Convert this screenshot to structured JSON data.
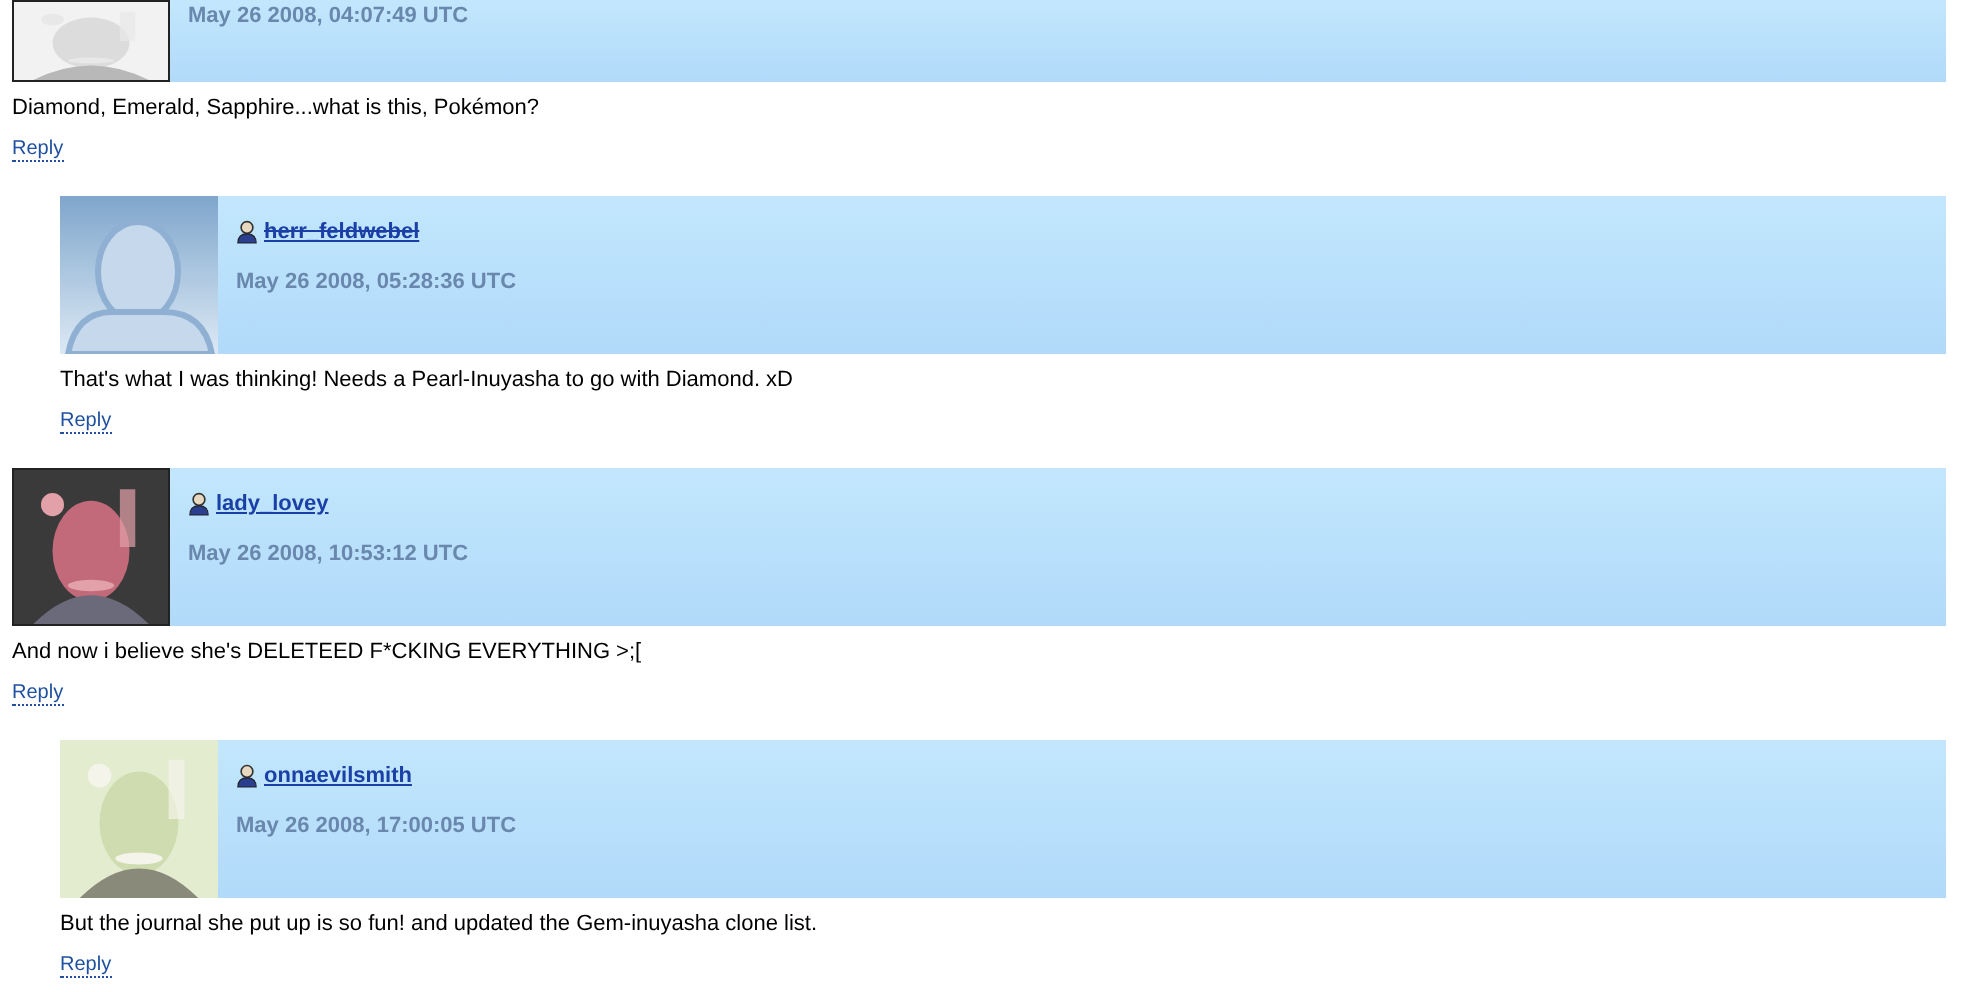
{
  "comments": [
    {
      "avatar": {
        "kind": "picture"
      },
      "date": "May 26 2008, 04:07:49 UTC",
      "text": "Diamond, Emerald, Sapphire...what is this, Pokémon?",
      "reply": "Reply",
      "children": [
        {
          "avatar": {
            "kind": "silhouette"
          },
          "username": "herr_feldwebel",
          "deleted": true,
          "date": "May 26 2008, 05:28:36 UTC",
          "text": "That's what I was thinking! Needs a Pearl-Inuyasha to go with Diamond. xD",
          "reply": "Reply"
        }
      ]
    },
    {
      "avatar": {
        "kind": "picture"
      },
      "username": "lady_lovey",
      "deleted": false,
      "date": "May 26 2008, 10:53:12 UTC",
      "text": "And now i believe she's DELETEED F*CKING EVERYTHING >;[",
      "reply": "Reply",
      "children": [
        {
          "avatar": {
            "kind": "picture"
          },
          "username": "onnaevilsmith",
          "deleted": false,
          "date": "May 26 2008, 17:00:05 UTC",
          "text": "But the journal she put up is so fun! and updated the Gem-inuyasha clone list.",
          "reply": "Reply"
        }
      ]
    }
  ]
}
